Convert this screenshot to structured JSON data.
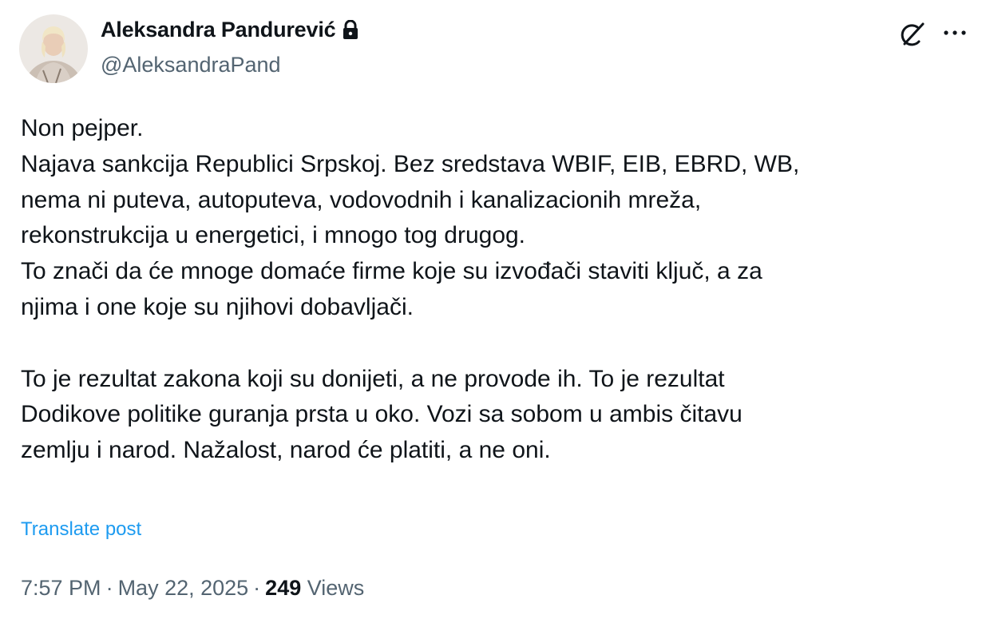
{
  "author": {
    "name": "Aleksandra Pandurević",
    "handle": "@AleksandraPand",
    "protected_icon": "lock-icon",
    "avatar_icon": "avatar"
  },
  "actions": {
    "grok_icon": "grok-icon",
    "more_icon": "more-icon"
  },
  "post": {
    "lines": [
      "Non pejper.",
      "Najava sankcija Republici Srpskoj. Bez sredstava WBIF, EIB, EBRD, WB,",
      "nema ni puteva, autoputeva, vodovodnih i kanalizacionih mreža,",
      "rekonstrukcija u energetici, i mnogo tog drugog.",
      "To znači da će mnoge domaće firme koje su izvođači staviti ključ, a za",
      "njima i one koje su njihovi dobavljači.",
      "",
      "To je rezultat zakona koji su donijeti, a ne provode ih. To je rezultat",
      "Dodikove politike guranja prsta u oko. Vozi sa sobom u ambis čitavu",
      "zemlju i narod. Nažalost, narod će platiti, a ne oni."
    ],
    "translate_label": "Translate post"
  },
  "meta": {
    "time": "7:57 PM",
    "separator": "·",
    "date": "May 22, 2025",
    "views_count": "249",
    "views_label": "Views"
  },
  "colors": {
    "text": "#0f1419",
    "secondary": "#536471",
    "link": "#1d9bf0"
  }
}
